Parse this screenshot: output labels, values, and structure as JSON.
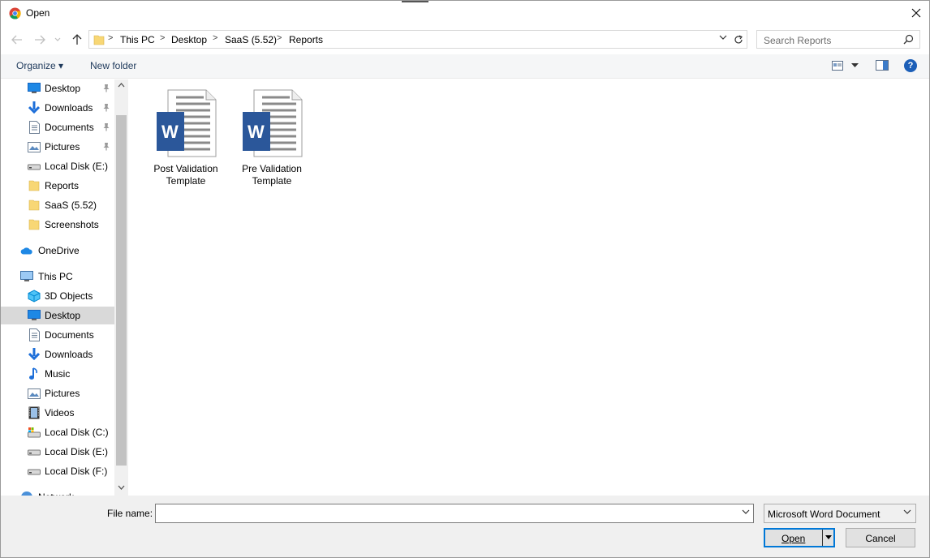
{
  "window": {
    "title": "Open"
  },
  "address": {
    "crumbs": [
      "This PC",
      "Desktop",
      "SaaS (5.52)",
      "Reports"
    ],
    "separator": ">"
  },
  "search": {
    "placeholder": "Search Reports"
  },
  "toolbar": {
    "organize": "Organize ▾",
    "new_folder": "New folder",
    "help": "?"
  },
  "nav": {
    "quick_access": [
      {
        "label": "Desktop",
        "icon": "desktop-icon",
        "pinned": true
      },
      {
        "label": "Downloads",
        "icon": "download-icon",
        "pinned": true
      },
      {
        "label": "Documents",
        "icon": "documents-icon",
        "pinned": true
      },
      {
        "label": "Pictures",
        "icon": "pictures-icon",
        "pinned": true
      },
      {
        "label": "Local Disk (E:)",
        "icon": "drive-icon",
        "pinned": false
      },
      {
        "label": "Reports",
        "icon": "folder-icon",
        "pinned": false
      },
      {
        "label": "SaaS (5.52)",
        "icon": "folder-icon",
        "pinned": false
      },
      {
        "label": "Screenshots",
        "icon": "folder-icon",
        "pinned": false
      }
    ],
    "onedrive": "OneDrive",
    "this_pc": "This PC",
    "this_pc_items": [
      {
        "label": "3D Objects",
        "icon": "3d-objects-icon"
      },
      {
        "label": "Desktop",
        "icon": "desktop-icon",
        "selected": true
      },
      {
        "label": "Documents",
        "icon": "documents-icon"
      },
      {
        "label": "Downloads",
        "icon": "download-icon"
      },
      {
        "label": "Music",
        "icon": "music-icon"
      },
      {
        "label": "Pictures",
        "icon": "pictures-icon"
      },
      {
        "label": "Videos",
        "icon": "videos-icon"
      },
      {
        "label": "Local Disk (C:)",
        "icon": "system-drive-icon"
      },
      {
        "label": "Local Disk (E:)",
        "icon": "drive-icon"
      },
      {
        "label": "Local Disk (F:)",
        "icon": "drive-icon"
      }
    ],
    "network": "Network"
  },
  "files": [
    {
      "name_line1": "Post Validation",
      "name_line2": "Template",
      "icon": "word-document-icon"
    },
    {
      "name_line1": "Pre Validation",
      "name_line2": "Template",
      "icon": "word-document-icon"
    }
  ],
  "bottom": {
    "file_name_label": "File name:",
    "file_name_value": "",
    "file_type": "Microsoft Word Document",
    "open": "Open",
    "cancel": "Cancel"
  },
  "colors": {
    "accent": "#0078d7",
    "word_blue": "#2b579a",
    "folder": "#f8d775"
  }
}
